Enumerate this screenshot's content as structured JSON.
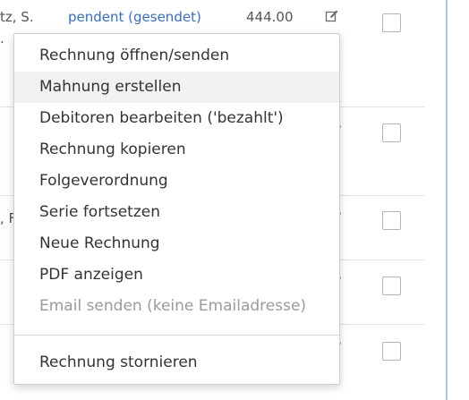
{
  "table": {
    "row1": {
      "name_fragment": "tz, S.",
      "name_fragment_line2": ".",
      "status": "pendent (gesendet)",
      "amount": "444.00",
      "edit_icon": "edit-icon"
    },
    "row2": {
      "name_fragment": ""
    },
    "row3": {
      "name_fragment": ", F"
    },
    "row4": {
      "name_fragment": ""
    },
    "row5": {
      "name_fragment": ""
    }
  },
  "context_menu": {
    "items": [
      {
        "label": "Rechnung öffnen/senden",
        "state": "normal"
      },
      {
        "label": "Mahnung erstellen",
        "state": "hover"
      },
      {
        "label": "Debitoren bearbeiten ('bezahlt')",
        "state": "normal"
      },
      {
        "label": "Rechnung kopieren",
        "state": "normal"
      },
      {
        "label": "Folgeverordnung",
        "state": "normal"
      },
      {
        "label": "Serie fortsetzen",
        "state": "normal"
      },
      {
        "label": "Neue Rechnung",
        "state": "normal"
      },
      {
        "label": "PDF anzeigen",
        "state": "normal"
      },
      {
        "label": "Email senden (keine Emailadresse)",
        "state": "disabled"
      },
      {
        "label": "Rechnung stornieren",
        "state": "normal"
      }
    ]
  },
  "colors": {
    "status_link": "#3a6fb5",
    "hover_bg": "#f2f2f2",
    "disabled_text": "#9b9b9b",
    "panel_border": "#a9c6e4"
  }
}
